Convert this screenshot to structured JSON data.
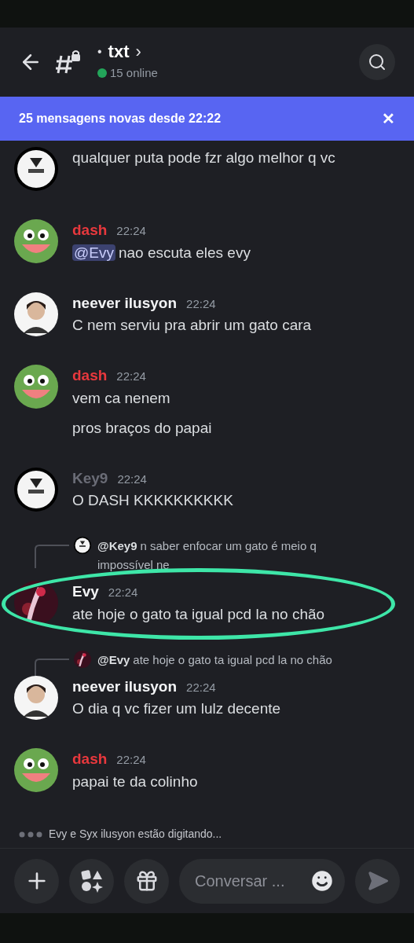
{
  "header": {
    "channel": "txt",
    "unread_dot": "•",
    "chevron": "›",
    "online": "15 online"
  },
  "banner": {
    "text": "25 mensagens novas desde 22:22",
    "close": "✕"
  },
  "messages": [
    {
      "kind": "cut",
      "avatar": {
        "kind": "logo"
      },
      "lines": [
        "qualquer puta pode fzr algo melhor q vc"
      ]
    },
    {
      "kind": "message",
      "avatar": {
        "kind": "frog"
      },
      "author": "dash",
      "color": "#e8383d",
      "time": "22:24",
      "mention": "@Evy",
      "lines": [
        "nao escuta eles evy"
      ]
    },
    {
      "kind": "message",
      "avatar": {
        "kind": "photo"
      },
      "author": "neever ilusyon",
      "color": "#f2f3f5",
      "time": "22:24",
      "lines": [
        "C nem serviu pra abrir um gato cara"
      ]
    },
    {
      "kind": "message",
      "avatar": {
        "kind": "frog"
      },
      "author": "dash",
      "color": "#e8383d",
      "time": "22:24",
      "lines": [
        "vem ca nenem",
        "pros braços do papai"
      ]
    },
    {
      "kind": "message",
      "avatar": {
        "kind": "logo"
      },
      "author": "Key9",
      "color": "#6a6c76",
      "time": "22:24",
      "lines": [
        "O DASH KKKKKKKKKK"
      ]
    },
    {
      "kind": "message",
      "avatar": {
        "kind": "anime"
      },
      "author": "Evy",
      "color": "#f2f3f5",
      "time": "22:24",
      "highlighted": true,
      "reply": {
        "avatar": {
          "kind": "logo"
        },
        "mention": "@Key9",
        "text": "n saber enfocar um gato é meio q impossível ne"
      },
      "lines": [
        "ate hoje o gato ta igual pcd la no chão"
      ]
    },
    {
      "kind": "message",
      "avatar": {
        "kind": "photo"
      },
      "author": "neever ilusyon",
      "color": "#f2f3f5",
      "time": "22:24",
      "reply": {
        "avatar": {
          "kind": "anime"
        },
        "mention": "@Evy",
        "text": "ate hoje o gato ta igual pcd la no chão"
      },
      "lines": [
        "O dia q vc fizer um lulz decente"
      ]
    },
    {
      "kind": "message",
      "avatar": {
        "kind": "frog"
      },
      "author": "dash",
      "color": "#e8383d",
      "time": "22:24",
      "lines": [
        "papai te da colinho"
      ]
    }
  ],
  "typing": "Evy e Syx ilusyon estão digitando...",
  "composer": {
    "placeholder": "Conversar ..."
  }
}
